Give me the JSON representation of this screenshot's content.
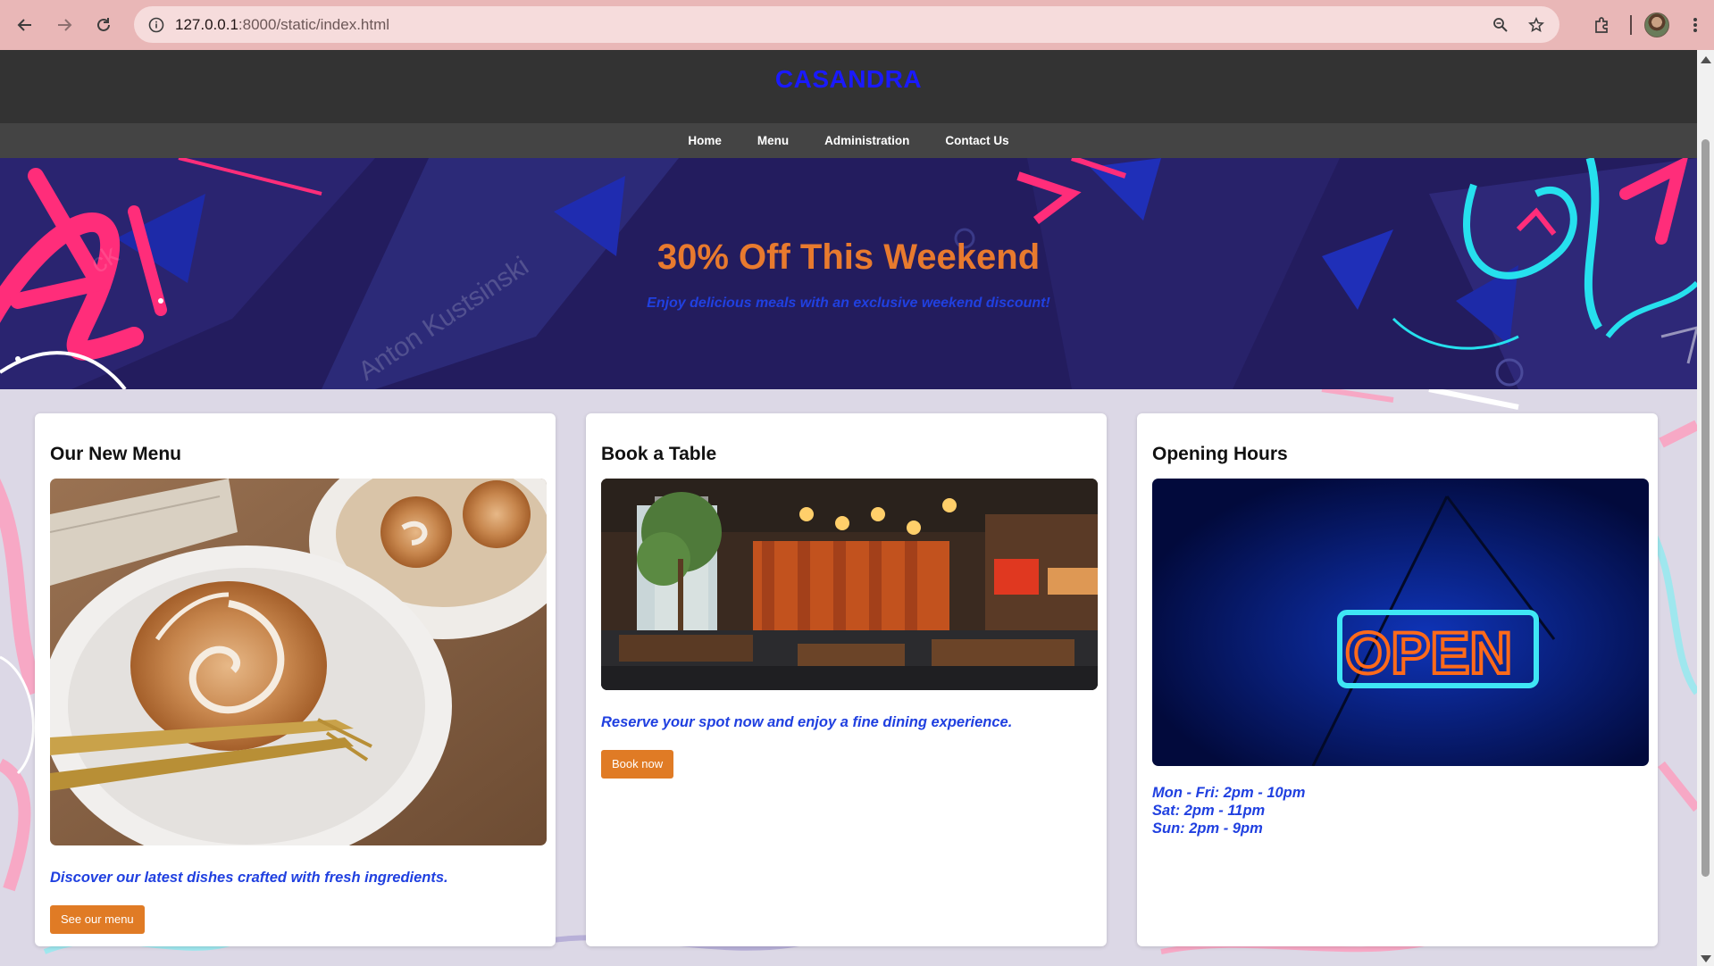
{
  "browser": {
    "url_host": "127.0.0.1",
    "url_path": ":8000/static/index.html",
    "icons": [
      "back-arrow-icon",
      "forward-arrow-icon",
      "reload-icon",
      "site-info-icon",
      "zoom-icon",
      "bookmark-star-icon",
      "extensions-icon",
      "profile-avatar",
      "more-menu-icon"
    ]
  },
  "site": {
    "brand": "CASANDRA",
    "nav": [
      "Home",
      "Menu",
      "Administration",
      "Contact Us"
    ]
  },
  "hero": {
    "title": "30% Off This Weekend",
    "subtitle": "Enjoy delicious meals with an exclusive weekend discount!",
    "watermark": "Anton Kustsinski"
  },
  "cards": [
    {
      "title": "Our New Menu",
      "description": "Discover our latest dishes crafted with fresh ingredients.",
      "button": "See our menu"
    },
    {
      "title": "Book a Table",
      "description": "Reserve your spot now and enjoy a fine dining experience.",
      "button": "Book now"
    },
    {
      "title": "Opening Hours",
      "sign_text": "OPEN",
      "hours": [
        "Mon - Fri: 2pm - 10pm",
        "Sat: 2pm - 11pm",
        "Sun: 2pm - 9pm"
      ]
    }
  ],
  "colors": {
    "brand": "#1a1aff",
    "accent_orange": "#e07b25",
    "link_blue": "#2040e0",
    "header_bg": "#333333",
    "nav_bg": "#444444",
    "hero_bg": "#231c5e"
  }
}
